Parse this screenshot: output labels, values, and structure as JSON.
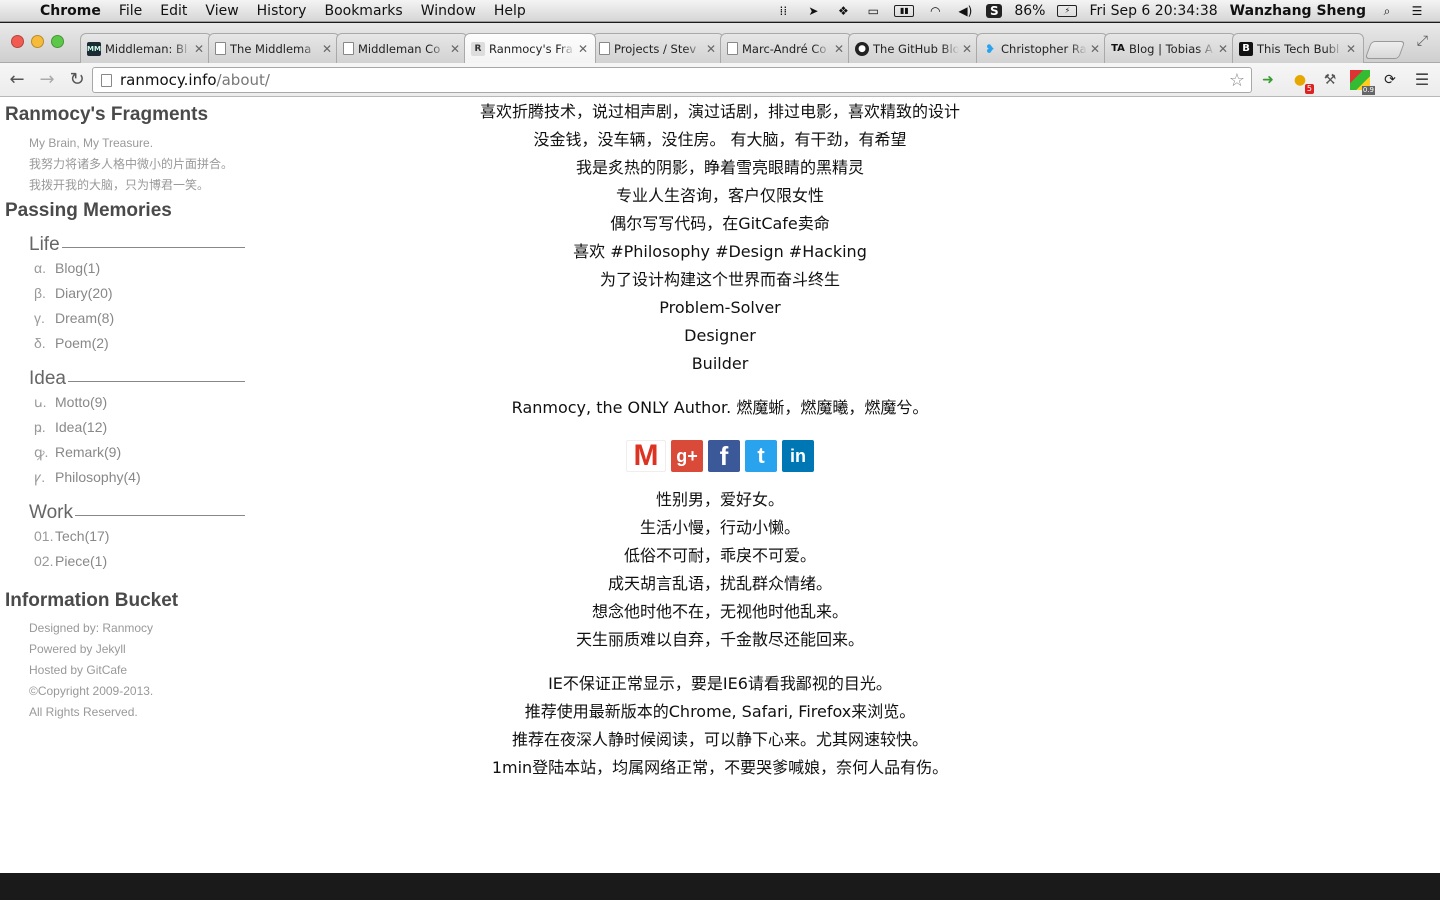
{
  "menubar": {
    "app_name": "Chrome",
    "menus": [
      "File",
      "Edit",
      "View",
      "History",
      "Bookmarks",
      "Window",
      "Help"
    ],
    "battery": "86%",
    "clock": "Fri Sep 6  20:34:38",
    "user": "Wanzhang Sheng"
  },
  "tabs": [
    {
      "title": "Middleman: Bl",
      "favicon": "mm"
    },
    {
      "title": "The Middlema",
      "favicon": "doc"
    },
    {
      "title": "Middleman Co",
      "favicon": "doc"
    },
    {
      "title": "Ranmocy's Fra",
      "favicon": "r"
    },
    {
      "title": "Projects / Stev",
      "favicon": "doc"
    },
    {
      "title": "Marc-André Co",
      "favicon": "doc"
    },
    {
      "title": "The GitHub Blo",
      "favicon": "gh"
    },
    {
      "title": "Christopher Ra",
      "favicon": "tw"
    },
    {
      "title": "Blog | Tobias A",
      "favicon": "ta"
    },
    {
      "title": "This Tech Bubl",
      "favicon": "b"
    }
  ],
  "toolbar": {
    "url_host": "ranmocy.info",
    "url_path": "/about/",
    "ext_badge_count": "5",
    "ext_colors_badge": "0.9"
  },
  "sidebar": {
    "site_title": "Ranmocy's Fragments",
    "desc": [
      "My Brain, My Treasure.",
      "我努力将诸多人格中微小的片面拼合。",
      "我拨开我的大脑，只为博君一笑。"
    ],
    "section_title": "Passing Memories",
    "groups": [
      {
        "title": "Life",
        "items": [
          {
            "marker": "α.",
            "name": "Blog(1)"
          },
          {
            "marker": "β.",
            "name": "Diary(20)"
          },
          {
            "marker": "γ.",
            "name": "Dream(8)"
          },
          {
            "marker": "δ.",
            "name": "Poem(2)"
          }
        ]
      },
      {
        "title": "Idea",
        "items": [
          {
            "marker": "ꭎ.",
            "name": "Motto(9)"
          },
          {
            "marker": "ҏ.",
            "name": "Idea(12)"
          },
          {
            "marker": "ꝙ.",
            "name": "Remark(9)"
          },
          {
            "marker": "ꝩ.",
            "name": "Philosophy(4)"
          }
        ]
      },
      {
        "title": "Work",
        "items": [
          {
            "marker": "01.",
            "name": "Tech(17)"
          },
          {
            "marker": "02.",
            "name": "Piece(1)"
          }
        ]
      }
    ],
    "info_title": "Information Bucket",
    "info": [
      "Designed by: Ranmocy",
      "Powered by Jekyll",
      "Hosted by GitCafe",
      "©Copyright 2009-2013.",
      "All Rights Reserved."
    ]
  },
  "content": {
    "intro": [
      "喜欢折腾技术，说过相声剧，演过话剧，排过电影，喜欢精致的设计",
      "没金钱，没车辆，没住房。 有大脑，有干劲，有希望",
      "我是炙热的阴影，睁着雪亮眼睛的黑精灵",
      "专业人生咨询，客户仅限女性",
      "偶尔写写代码，在GitCafe卖命",
      "喜欢 #Philosophy #Design #Hacking",
      "为了设计构建这个世界而奋斗终生",
      "Problem-Solver",
      "Designer",
      "Builder"
    ],
    "author_line": "Ranmocy, the ONLY Author. 燃魔蜥，燃魔曦，燃魔兮。",
    "social": [
      "gmail",
      "google-plus",
      "facebook",
      "twitter",
      "linkedin"
    ],
    "traits": [
      "性别男，爱好女。",
      "生活小慢，行动小懒。",
      "低俗不可耐，乖戾不可爱。",
      "成天胡言乱语，扰乱群众情绪。",
      "想念他时他不在，无视他时他乱来。",
      "天生丽质难以自弃，千金散尽还能回来。"
    ],
    "notes": [
      "IE不保证正常显示，要是IE6请看我鄙视的目光。",
      "推荐使用最新版本的Chrome, Safari, Firefox来浏览。",
      "推荐在夜深人静时候阅读，可以静下心来。尤其网速较快。",
      "1min登陆本站，均属网络正常，不要哭爹喊娘，奈何人品有伤。"
    ]
  }
}
